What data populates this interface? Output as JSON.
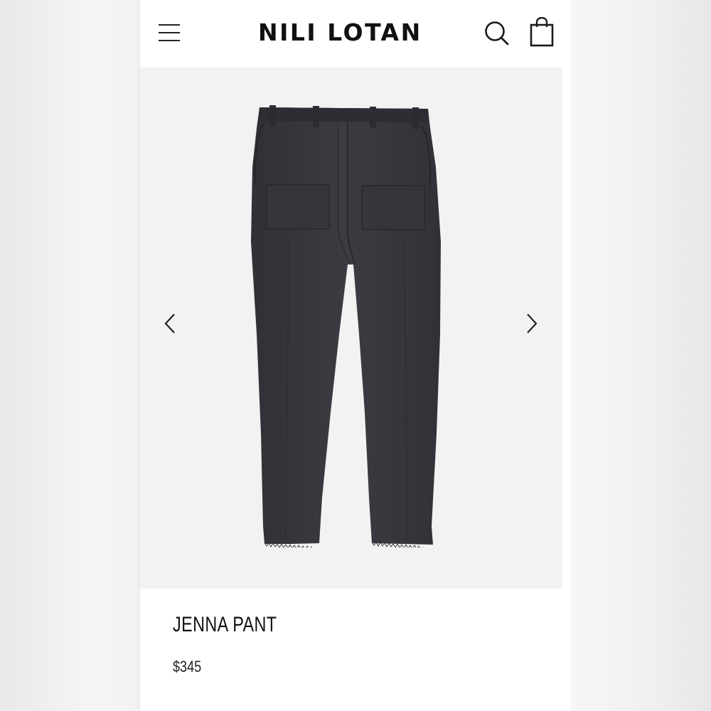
{
  "header": {
    "brand": "NILI LOTAN",
    "menu_icon": "hamburger-menu-icon",
    "search_icon": "search-icon",
    "bag_icon": "shopping-bag-icon"
  },
  "gallery": {
    "image_subject": "dark charcoal utility pant with patch pockets",
    "prev_icon": "chevron-left-icon",
    "next_icon": "chevron-right-icon",
    "background_color": "#f2f2f2",
    "garment_color": "#36383d"
  },
  "product": {
    "name": "JENNA PANT",
    "price": "$345"
  }
}
